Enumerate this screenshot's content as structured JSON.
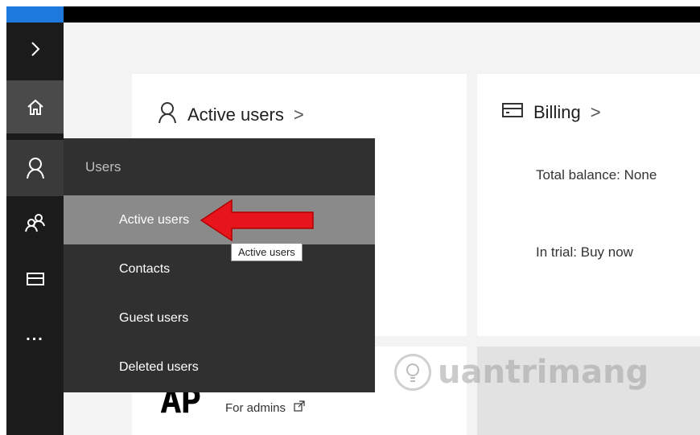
{
  "flyout": {
    "header": "Users",
    "items": [
      {
        "label": "Active users",
        "selected": true
      },
      {
        "label": "Contacts",
        "selected": false
      },
      {
        "label": "Guest users",
        "selected": false
      },
      {
        "label": "Deleted users",
        "selected": false
      }
    ]
  },
  "tooltip": "Active users",
  "cards": {
    "active_users": {
      "title": "Active users",
      "chevron": ">"
    },
    "billing": {
      "title": "Billing",
      "chevron": ">",
      "total_balance": "Total balance: None",
      "trial": "In trial: Buy now"
    },
    "admin_app": {
      "link": "For admins"
    }
  },
  "rail": {
    "icons": [
      "chevron-right-icon",
      "home-icon",
      "user-icon",
      "groups-icon",
      "billing-card-icon",
      "more-icon"
    ],
    "more_label": "..."
  },
  "watermark": "uantrimang",
  "colors": {
    "accent": "#1f7ae0",
    "rail": "#1b1b1b",
    "flyout": "#303030",
    "selected": "#8a8a8a",
    "arrow": "#e8141c"
  }
}
